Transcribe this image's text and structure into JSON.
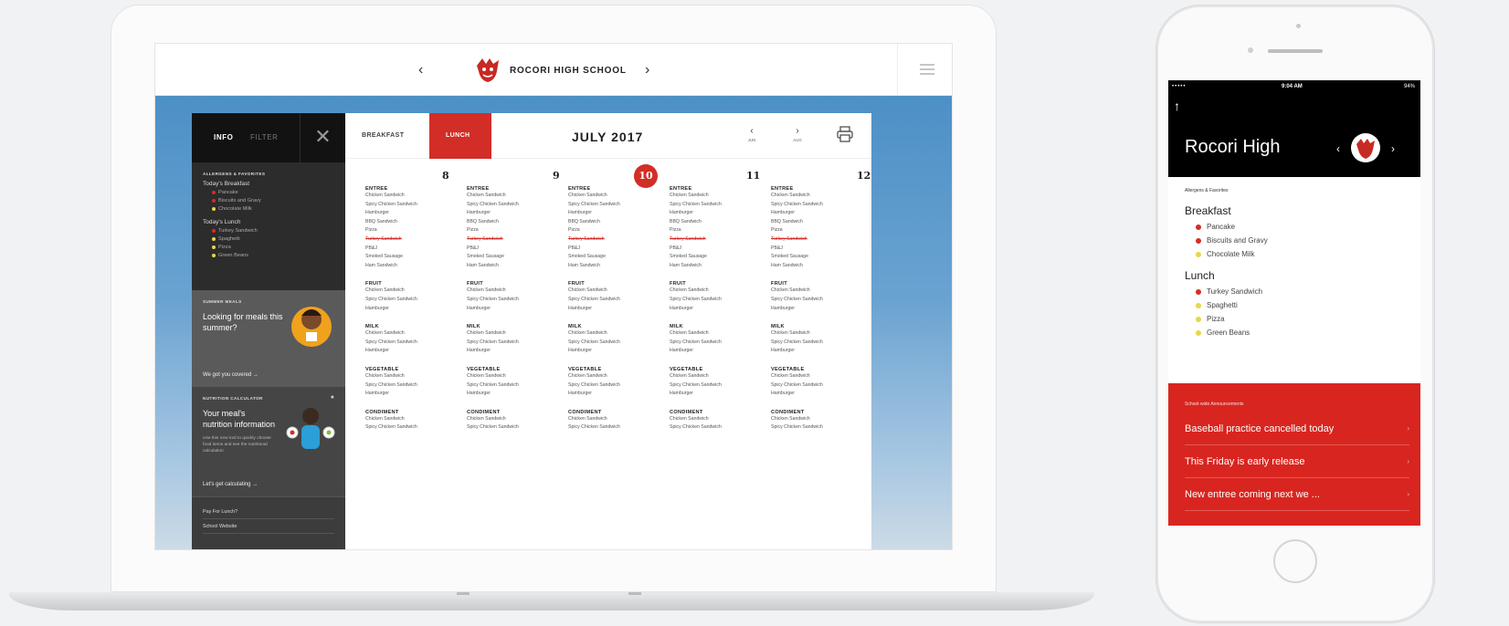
{
  "laptop": {
    "topbar": {
      "prev_icon": "chevron-left-icon",
      "title": "ROCORI HIGH SCHOOL",
      "next_icon": "chevron-right-icon",
      "menu_icon": "hamburger-menu-icon"
    },
    "sidebar": {
      "tab_info": "INFO",
      "tab_filter": "FILTER",
      "close_icon": "close-icon",
      "allergens_caption": "ALLERGENS & FAVORITES",
      "breakfast_title": "Today's Breakfast",
      "breakfast_items": [
        {
          "label": "Pancake",
          "color": "#d32d27"
        },
        {
          "label": "Biscuits and Gravy",
          "color": "#d32d27"
        },
        {
          "label": "Chocolate Milk",
          "color": "#e8d64a"
        }
      ],
      "lunch_title": "Today's Lunch",
      "lunch_items": [
        {
          "label": "Turkey Sandwich",
          "color": "#d32d27"
        },
        {
          "label": "Spaghetti",
          "color": "#e8d64a"
        },
        {
          "label": "Pizza",
          "color": "#e8d64a"
        },
        {
          "label": "Green Beans",
          "color": "#e8d64a"
        }
      ],
      "summer_caption": "SUMMER MEALS",
      "summer_text": "Looking for meals this summer?",
      "summer_link": "We got you covered →",
      "calc_caption": "NUTRITION CALCULATOR",
      "calc_title": "Your meal's nutrition information",
      "calc_text": "Use this new tool to quickly choose food items and see the nutritional calculation",
      "calc_link": "Let's get calculating →",
      "footer_links": [
        "Pay For Lunch?",
        "School Website"
      ]
    },
    "calendar": {
      "tab_breakfast": "BREAKFAST",
      "tab_lunch": "LUNCH",
      "month": "JULY 2017",
      "prev_label": "JUN",
      "next_label": "AUG",
      "print_icon": "printer-icon",
      "days": [
        {
          "num": "8",
          "today": false
        },
        {
          "num": "9",
          "today": false
        },
        {
          "num": "10",
          "today": true
        },
        {
          "num": "11",
          "today": false
        },
        {
          "num": "12",
          "today": false
        }
      ],
      "categories": [
        {
          "name": "ENTREE",
          "items": [
            "Chicken Sandwich",
            "Spicy Chicken Sandwich",
            "Hamburger",
            "BBQ Sandwich",
            "Pizza",
            "Turkey Sandwich",
            "PB&J",
            "Smoked Sausage",
            "Ham Sandwich"
          ],
          "strike_index": 5
        },
        {
          "name": "FRUIT",
          "items": [
            "Chicken Sandwich",
            "Spicy Chicken Sandwich",
            "Hamburger"
          ],
          "strike_index": -1
        },
        {
          "name": "MILK",
          "items": [
            "Chicken Sandwich",
            "Spicy Chicken Sandwich",
            "Hamburger"
          ],
          "strike_index": -1
        },
        {
          "name": "VEGETABLE",
          "items": [
            "Chicken Sandwich",
            "Spicy Chicken Sandwich",
            "Hamburger"
          ],
          "strike_index": -1
        },
        {
          "name": "CONDIMENT",
          "items": [
            "Chicken Sandwich",
            "Spicy Chicken Sandwich"
          ],
          "strike_index": -1
        }
      ]
    }
  },
  "phone": {
    "status": {
      "carrier": "•••••",
      "time": "9:04 AM",
      "battery": "94%"
    },
    "back_icon": "up-arrow-icon",
    "title": "Rocori High",
    "allergens_caption": "Allergens & Favorites",
    "breakfast_title": "Breakfast",
    "breakfast_items": [
      {
        "label": "Pancake",
        "color": "#d32d27"
      },
      {
        "label": "Biscuits and Gravy",
        "color": "#d32d27"
      },
      {
        "label": "Chocolate Milk",
        "color": "#e8d64a"
      }
    ],
    "lunch_title": "Lunch",
    "lunch_items": [
      {
        "label": "Turkey Sandwich",
        "color": "#d32d27"
      },
      {
        "label": "Spaghetti",
        "color": "#e8d64a"
      },
      {
        "label": "Pizza",
        "color": "#e8d64a"
      },
      {
        "label": "Green Beans",
        "color": "#e8d64a"
      }
    ],
    "announcements_caption": "School-wide Announcements",
    "announcements": [
      "Baseball practice cancelled today",
      "This Friday is early release",
      "New entree coming next we ..."
    ]
  },
  "colors": {
    "accent": "#d32d27",
    "sky": "#4d90c6",
    "sidebar": "#333333"
  }
}
